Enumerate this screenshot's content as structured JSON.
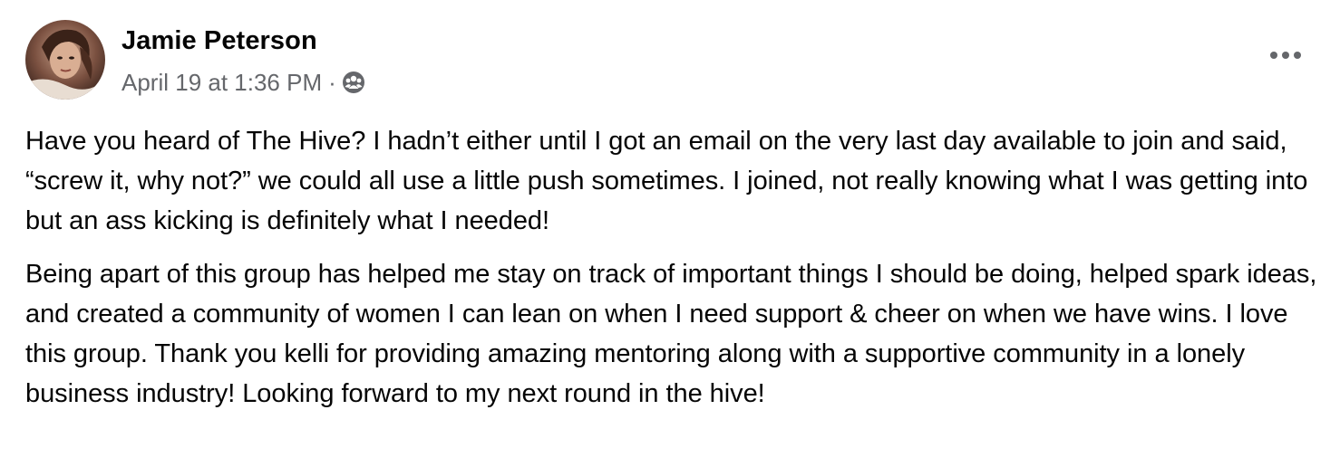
{
  "post": {
    "author": "Jamie Peterson",
    "timestamp": "April 19 at 1:36 PM",
    "separator": "·",
    "audience_icon": "group-audience-icon",
    "avatar_icon": "profile-photo",
    "more_icon": "more-options-icon",
    "paragraphs": [
      "Have you heard of The Hive? I hadn’t either until I got an email on the very last day available to join and said, “screw it, why not?” we could all use a little push sometimes. I joined, not really knowing what I was getting into but an ass kicking is definitely what I needed!",
      "Being apart of this group has helped me stay on track of important things I should be doing, helped spark ideas, and created a community of women I can lean on when I need support & cheer on when we have wins. I love this group. Thank you kelli for providing amazing mentoring along with a supportive community in a lonely business industry! Looking forward to my next round in the hive!"
    ]
  },
  "colors": {
    "text_primary": "#050505",
    "text_secondary": "#65676b",
    "background": "#ffffff"
  }
}
